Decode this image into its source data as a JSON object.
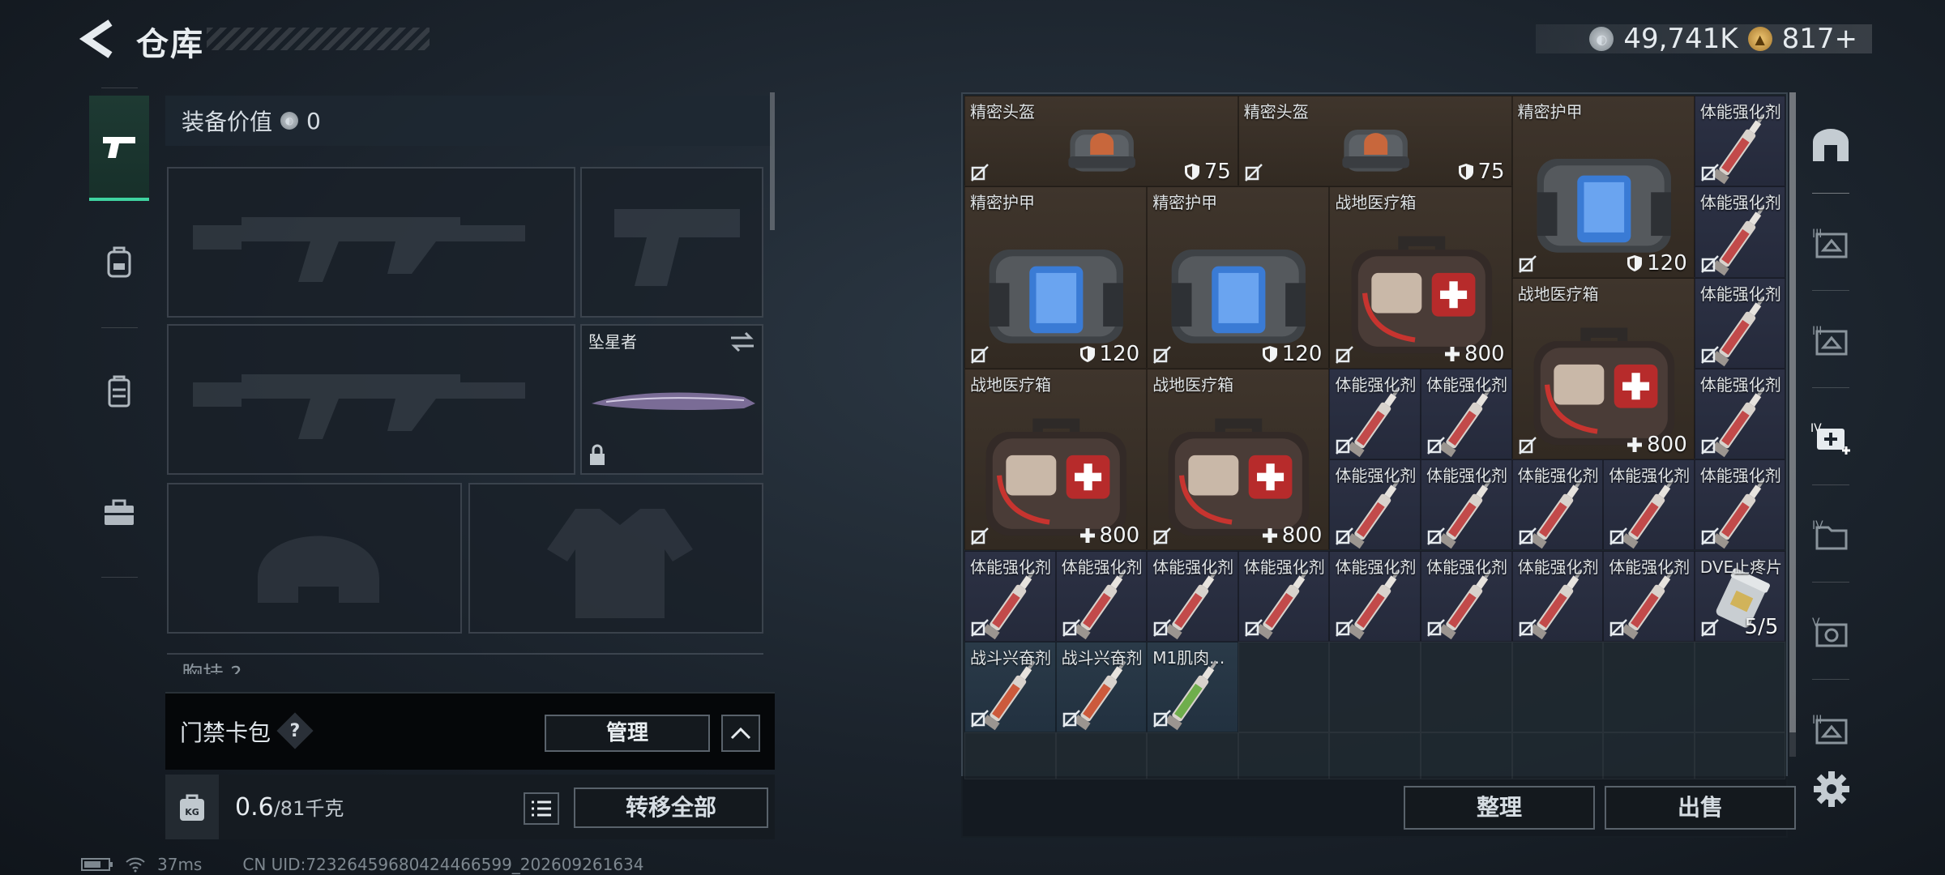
{
  "header": {
    "title": "仓库"
  },
  "currency": {
    "silver": "49,741K",
    "gold": "817+"
  },
  "loadout": {
    "equip_value_label": "装备价值",
    "equip_value": "0",
    "melee_name": "坠星者",
    "chest_label": "胸挂 ?",
    "keycard_label": "门禁卡包",
    "help": "?",
    "manage_label": "管理",
    "weight_value": "0.6",
    "weight_max": "/81千克",
    "bag_label": "KG",
    "transfer_label": "转移全部"
  },
  "storage": {
    "items": [
      {
        "name": "精密头盔",
        "value": "75",
        "icon": "durability-shield-icon",
        "art": "helmet",
        "bg": "brown"
      },
      {
        "name": "精密头盔",
        "value": "75",
        "icon": "durability-shield-icon",
        "art": "helmet",
        "bg": "brown"
      },
      {
        "name": "精密护甲",
        "value": "120",
        "icon": "durability-shield-icon",
        "art": "armor",
        "bg": "brown"
      },
      {
        "name": "体能强化剂",
        "value": "",
        "icon": "",
        "art": "syringe-red",
        "bg": "navy"
      },
      {
        "name": "精密护甲",
        "value": "120",
        "icon": "durability-shield-icon",
        "art": "armor",
        "bg": "brown"
      },
      {
        "name": "精密护甲",
        "value": "120",
        "icon": "durability-shield-icon",
        "art": "armor",
        "bg": "brown"
      },
      {
        "name": "战地医疗箱",
        "value": "800",
        "icon": "heal-plus-icon",
        "art": "medkit",
        "bg": "brown"
      },
      {
        "name": "体能强化剂",
        "value": "",
        "icon": "",
        "art": "syringe-red",
        "bg": "navy"
      },
      {
        "name": "战地医疗箱",
        "value": "800",
        "icon": "heal-plus-icon",
        "art": "medkit",
        "bg": "brown"
      },
      {
        "name": "体能强化剂",
        "value": "",
        "icon": "",
        "art": "syringe-red",
        "bg": "navy"
      },
      {
        "name": "战地医疗箱",
        "value": "800",
        "icon": "heal-plus-icon",
        "art": "medkit",
        "bg": "brown"
      },
      {
        "name": "战地医疗箱",
        "value": "800",
        "icon": "heal-plus-icon",
        "art": "medkit",
        "bg": "brown"
      },
      {
        "name": "体能强化剂",
        "value": "",
        "icon": "",
        "art": "syringe-red",
        "bg": "navy"
      },
      {
        "name": "体能强化剂",
        "value": "",
        "icon": "",
        "art": "syringe-red",
        "bg": "navy"
      },
      {
        "name": "体能强化剂",
        "value": "",
        "icon": "",
        "art": "syringe-red",
        "bg": "navy"
      },
      {
        "name": "体能强化剂",
        "value": "",
        "icon": "",
        "art": "syringe-red",
        "bg": "navy"
      },
      {
        "name": "体能强化剂",
        "value": "",
        "icon": "",
        "art": "syringe-red",
        "bg": "navy"
      },
      {
        "name": "体能强化剂",
        "value": "",
        "icon": "",
        "art": "syringe-red",
        "bg": "navy"
      },
      {
        "name": "体能强化剂",
        "value": "",
        "icon": "",
        "art": "syringe-red",
        "bg": "navy"
      },
      {
        "name": "体能强化剂",
        "value": "",
        "icon": "",
        "art": "syringe-red",
        "bg": "navy"
      },
      {
        "name": "体能强化剂",
        "value": "",
        "icon": "",
        "art": "syringe-red",
        "bg": "navy"
      },
      {
        "name": "体能强化剂",
        "value": "",
        "icon": "",
        "art": "syringe-red",
        "bg": "navy"
      },
      {
        "name": "体能强化剂",
        "value": "",
        "icon": "",
        "art": "syringe-red",
        "bg": "navy"
      },
      {
        "name": "体能强化剂",
        "value": "",
        "icon": "",
        "art": "syringe-red",
        "bg": "navy"
      },
      {
        "name": "体能强化剂",
        "value": "",
        "icon": "",
        "art": "syringe-red",
        "bg": "navy"
      },
      {
        "name": "体能强化剂",
        "value": "",
        "icon": "",
        "art": "syringe-red",
        "bg": "navy"
      },
      {
        "name": "体能强化剂",
        "value": "",
        "icon": "",
        "art": "syringe-red",
        "bg": "navy"
      },
      {
        "name": "体能强化剂",
        "value": "",
        "icon": "",
        "art": "syringe-red",
        "bg": "navy"
      },
      {
        "name": "DVE止疼片",
        "value": "5/5",
        "icon": "",
        "art": "pills",
        "bg": "navy"
      },
      {
        "name": "战斗兴奋剂",
        "value": "",
        "icon": "",
        "art": "syringe-orange",
        "bg": "teal"
      },
      {
        "name": "战斗兴奋剂",
        "value": "",
        "icon": "",
        "art": "syringe-orange",
        "bg": "teal"
      },
      {
        "name": "M1肌肉...",
        "value": "",
        "icon": "",
        "art": "syringe-green",
        "bg": "teal"
      }
    ],
    "sort_label": "整理",
    "sell_label": "出售"
  },
  "status": {
    "ping": "37ms",
    "uid": "CN UID:72326459680424466599_202609261634"
  },
  "colors": {
    "accent": "#3fd3a0",
    "brown_cell": "#3a3028",
    "navy_cell": "#282c3e",
    "teal_cell": "#263545"
  }
}
